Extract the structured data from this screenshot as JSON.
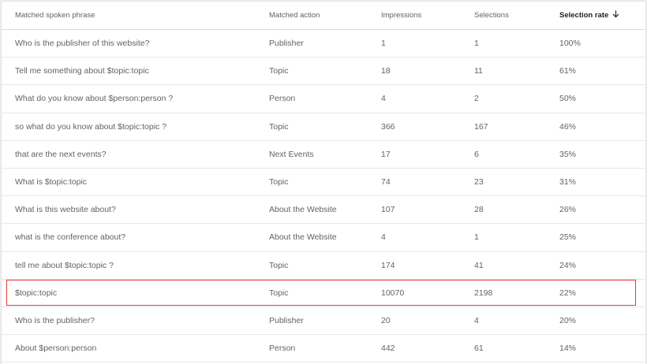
{
  "table": {
    "headers": [
      "Matched spoken phrase",
      "Matched action",
      "Impressions",
      "Selections",
      "Selection rate"
    ],
    "rows": [
      [
        "Who is the publisher of this website?",
        "Publisher",
        "1",
        "1",
        "100%"
      ],
      [
        "Tell me something about $topic:topic",
        "Topic",
        "18",
        "11",
        "61%"
      ],
      [
        "What do you know about $person:person ?",
        "Person",
        "4",
        "2",
        "50%"
      ],
      [
        "so what do you know about $topic:topic ?",
        "Topic",
        "366",
        "167",
        "46%"
      ],
      [
        "that are the next events?",
        "Next Events",
        "17",
        "6",
        "35%"
      ],
      [
        "What is $topic:topic",
        "Topic",
        "74",
        "23",
        "31%"
      ],
      [
        "What is this website about?",
        "About the Website",
        "107",
        "28",
        "26%"
      ],
      [
        "what is the conference about?",
        "About the Website",
        "4",
        "1",
        "25%"
      ],
      [
        "tell me about $topic:topic ?",
        "Topic",
        "174",
        "41",
        "24%"
      ],
      [
        "$topic:topic",
        "Topic",
        "10070",
        "2198",
        "22%"
      ],
      [
        "Who is the publisher?",
        "Publisher",
        "20",
        "4",
        "20%"
      ],
      [
        "About $person:person",
        "Person",
        "442",
        "61",
        "14%"
      ]
    ]
  },
  "sort": {
    "column": "Selection rate",
    "direction": "descending",
    "icon": "arrow-down-icon"
  },
  "highlight": {
    "row": "$topic:topic",
    "color": "#e53935"
  }
}
